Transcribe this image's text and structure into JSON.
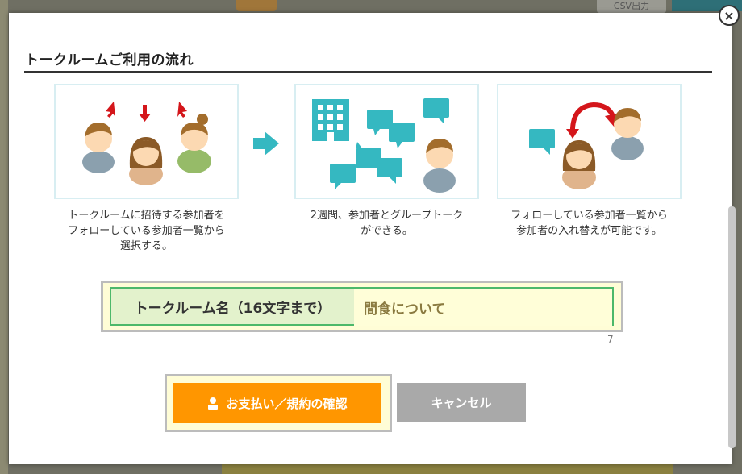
{
  "background": {
    "csv_label": "CSV出力"
  },
  "modal": {
    "title": "トークルームご利用の流れ",
    "close_symbol": "×",
    "steps": [
      {
        "caption": "トークルームに招待する参加者を\nフォローしている参加者一覧から\n選択する。"
      },
      {
        "caption": "2週間、参加者とグループトーク\nができる。"
      },
      {
        "caption": "フォローしている参加者一覧から\n参加者の入れ替えが可能です。"
      }
    ],
    "room_name": {
      "label": "トークルーム名（16文字まで）",
      "value": "間食について",
      "count": "7"
    },
    "buttons": {
      "pay": "お支払い／規約の確認",
      "cancel": "キャンセル"
    }
  },
  "colors": {
    "accent_orange": "#ff9600",
    "teal": "#35b8c1",
    "arrow_red": "#d4161b",
    "cancel_gray": "#a9a9a9"
  }
}
